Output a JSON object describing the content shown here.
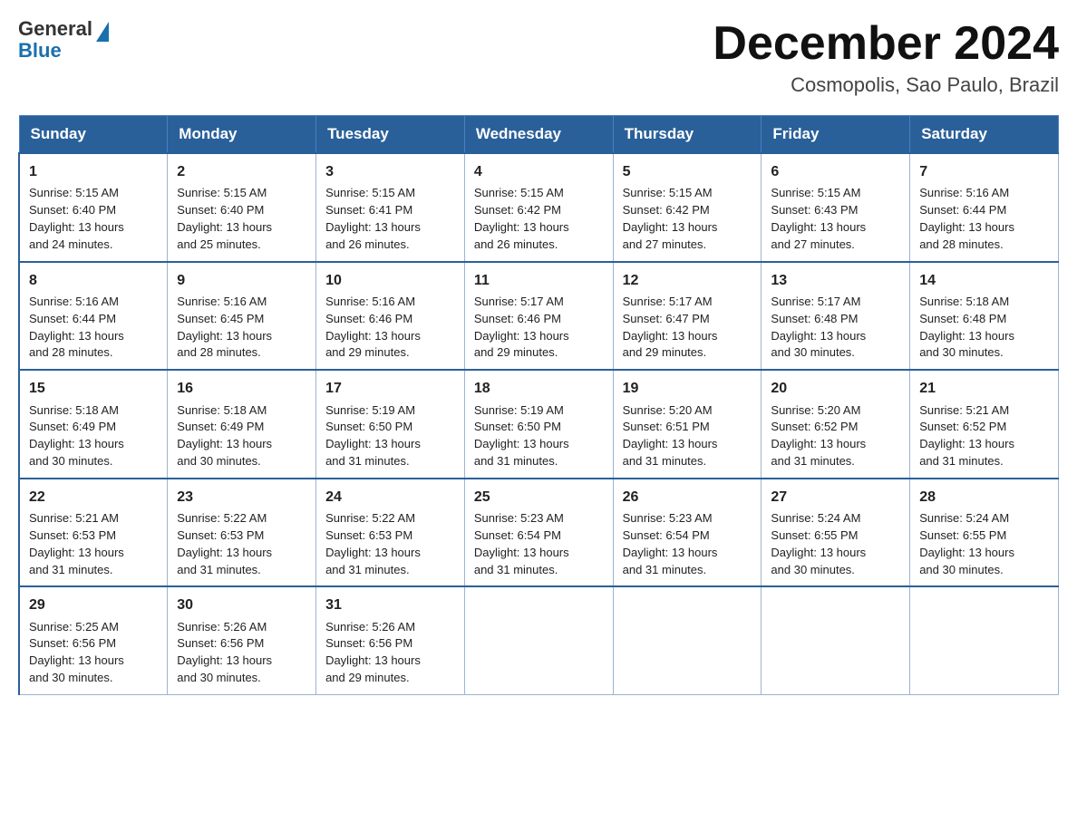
{
  "logo": {
    "general": "General",
    "blue": "Blue"
  },
  "title": "December 2024",
  "location": "Cosmopolis, Sao Paulo, Brazil",
  "days_of_week": [
    "Sunday",
    "Monday",
    "Tuesday",
    "Wednesday",
    "Thursday",
    "Friday",
    "Saturday"
  ],
  "weeks": [
    [
      {
        "day": "1",
        "info": "Sunrise: 5:15 AM\nSunset: 6:40 PM\nDaylight: 13 hours\nand 24 minutes."
      },
      {
        "day": "2",
        "info": "Sunrise: 5:15 AM\nSunset: 6:40 PM\nDaylight: 13 hours\nand 25 minutes."
      },
      {
        "day": "3",
        "info": "Sunrise: 5:15 AM\nSunset: 6:41 PM\nDaylight: 13 hours\nand 26 minutes."
      },
      {
        "day": "4",
        "info": "Sunrise: 5:15 AM\nSunset: 6:42 PM\nDaylight: 13 hours\nand 26 minutes."
      },
      {
        "day": "5",
        "info": "Sunrise: 5:15 AM\nSunset: 6:42 PM\nDaylight: 13 hours\nand 27 minutes."
      },
      {
        "day": "6",
        "info": "Sunrise: 5:15 AM\nSunset: 6:43 PM\nDaylight: 13 hours\nand 27 minutes."
      },
      {
        "day": "7",
        "info": "Sunrise: 5:16 AM\nSunset: 6:44 PM\nDaylight: 13 hours\nand 28 minutes."
      }
    ],
    [
      {
        "day": "8",
        "info": "Sunrise: 5:16 AM\nSunset: 6:44 PM\nDaylight: 13 hours\nand 28 minutes."
      },
      {
        "day": "9",
        "info": "Sunrise: 5:16 AM\nSunset: 6:45 PM\nDaylight: 13 hours\nand 28 minutes."
      },
      {
        "day": "10",
        "info": "Sunrise: 5:16 AM\nSunset: 6:46 PM\nDaylight: 13 hours\nand 29 minutes."
      },
      {
        "day": "11",
        "info": "Sunrise: 5:17 AM\nSunset: 6:46 PM\nDaylight: 13 hours\nand 29 minutes."
      },
      {
        "day": "12",
        "info": "Sunrise: 5:17 AM\nSunset: 6:47 PM\nDaylight: 13 hours\nand 29 minutes."
      },
      {
        "day": "13",
        "info": "Sunrise: 5:17 AM\nSunset: 6:48 PM\nDaylight: 13 hours\nand 30 minutes."
      },
      {
        "day": "14",
        "info": "Sunrise: 5:18 AM\nSunset: 6:48 PM\nDaylight: 13 hours\nand 30 minutes."
      }
    ],
    [
      {
        "day": "15",
        "info": "Sunrise: 5:18 AM\nSunset: 6:49 PM\nDaylight: 13 hours\nand 30 minutes."
      },
      {
        "day": "16",
        "info": "Sunrise: 5:18 AM\nSunset: 6:49 PM\nDaylight: 13 hours\nand 30 minutes."
      },
      {
        "day": "17",
        "info": "Sunrise: 5:19 AM\nSunset: 6:50 PM\nDaylight: 13 hours\nand 31 minutes."
      },
      {
        "day": "18",
        "info": "Sunrise: 5:19 AM\nSunset: 6:50 PM\nDaylight: 13 hours\nand 31 minutes."
      },
      {
        "day": "19",
        "info": "Sunrise: 5:20 AM\nSunset: 6:51 PM\nDaylight: 13 hours\nand 31 minutes."
      },
      {
        "day": "20",
        "info": "Sunrise: 5:20 AM\nSunset: 6:52 PM\nDaylight: 13 hours\nand 31 minutes."
      },
      {
        "day": "21",
        "info": "Sunrise: 5:21 AM\nSunset: 6:52 PM\nDaylight: 13 hours\nand 31 minutes."
      }
    ],
    [
      {
        "day": "22",
        "info": "Sunrise: 5:21 AM\nSunset: 6:53 PM\nDaylight: 13 hours\nand 31 minutes."
      },
      {
        "day": "23",
        "info": "Sunrise: 5:22 AM\nSunset: 6:53 PM\nDaylight: 13 hours\nand 31 minutes."
      },
      {
        "day": "24",
        "info": "Sunrise: 5:22 AM\nSunset: 6:53 PM\nDaylight: 13 hours\nand 31 minutes."
      },
      {
        "day": "25",
        "info": "Sunrise: 5:23 AM\nSunset: 6:54 PM\nDaylight: 13 hours\nand 31 minutes."
      },
      {
        "day": "26",
        "info": "Sunrise: 5:23 AM\nSunset: 6:54 PM\nDaylight: 13 hours\nand 31 minutes."
      },
      {
        "day": "27",
        "info": "Sunrise: 5:24 AM\nSunset: 6:55 PM\nDaylight: 13 hours\nand 30 minutes."
      },
      {
        "day": "28",
        "info": "Sunrise: 5:24 AM\nSunset: 6:55 PM\nDaylight: 13 hours\nand 30 minutes."
      }
    ],
    [
      {
        "day": "29",
        "info": "Sunrise: 5:25 AM\nSunset: 6:56 PM\nDaylight: 13 hours\nand 30 minutes."
      },
      {
        "day": "30",
        "info": "Sunrise: 5:26 AM\nSunset: 6:56 PM\nDaylight: 13 hours\nand 30 minutes."
      },
      {
        "day": "31",
        "info": "Sunrise: 5:26 AM\nSunset: 6:56 PM\nDaylight: 13 hours\nand 29 minutes."
      },
      {
        "day": "",
        "info": ""
      },
      {
        "day": "",
        "info": ""
      },
      {
        "day": "",
        "info": ""
      },
      {
        "day": "",
        "info": ""
      }
    ]
  ],
  "colors": {
    "header_bg": "#2a6099",
    "header_text": "#ffffff",
    "border": "#4a7fc1",
    "cell_border": "#9ab4d4"
  }
}
